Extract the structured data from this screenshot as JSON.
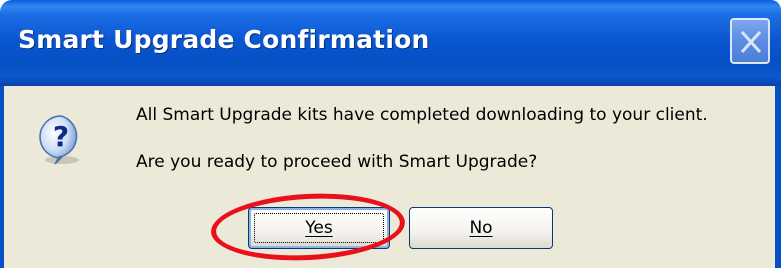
{
  "dialog": {
    "title": "Smart Upgrade Confirmation",
    "icon": "question-icon",
    "message_line1": "All Smart Upgrade kits have completed downloading to your client.",
    "message_line2": "Are you ready to proceed with Smart Upgrade?",
    "buttons": {
      "yes_label": "Yes",
      "no_label": "No"
    },
    "default_button": "Yes",
    "annotation": {
      "type": "red-ellipse-highlight",
      "target": "Yes",
      "color": "#e8111b"
    }
  },
  "colors": {
    "titlebar": "#0650c6",
    "client_background": "#ece9d8",
    "title_text": "#ffffff"
  }
}
